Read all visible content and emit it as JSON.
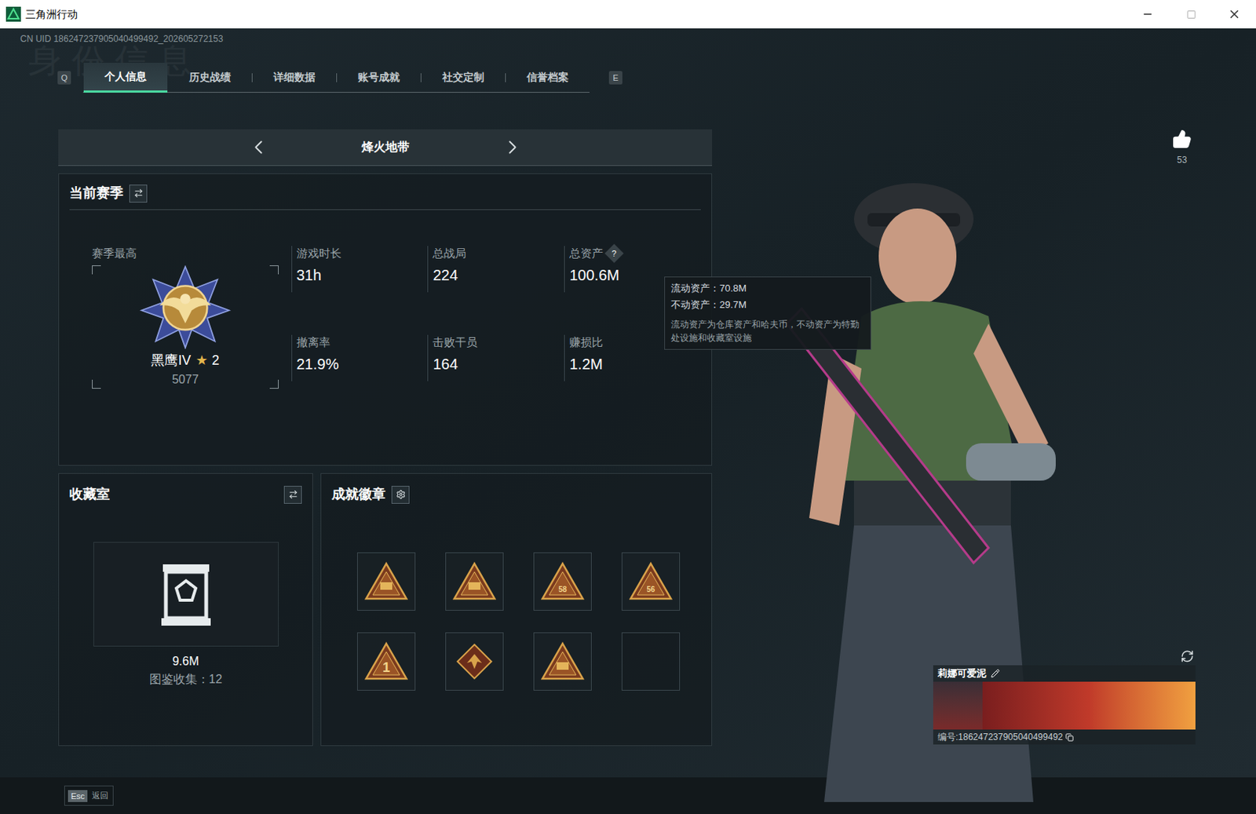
{
  "window": {
    "title": "三角洲行动"
  },
  "uid_line": "CN UID 186247237905040499492_202605272153",
  "watermark": "身份信息",
  "tabs": {
    "prev_key": "Q",
    "next_key": "E",
    "items": [
      {
        "label": "个人信息",
        "selected": true
      },
      {
        "label": "历史战绩",
        "selected": false
      },
      {
        "label": "详细数据",
        "selected": false
      },
      {
        "label": "账号成就",
        "selected": false
      },
      {
        "label": "社交定制",
        "selected": false
      },
      {
        "label": "信誉档案",
        "selected": false
      }
    ]
  },
  "mode": {
    "label": "烽火地带"
  },
  "season": {
    "title": "当前赛季",
    "rank_caption": "赛季最高",
    "rank_name": "黑鹰IV",
    "star": "★",
    "stars_text": "2",
    "score": "5077",
    "stats": [
      {
        "label": "游戏时长",
        "value": "31h"
      },
      {
        "label": "总战局",
        "value": "224"
      },
      {
        "label": "总资产",
        "value": "100.6M",
        "hint": "?"
      },
      {
        "label": "撤离率",
        "value": "21.9%"
      },
      {
        "label": "击败干员",
        "value": "164"
      },
      {
        "label": "赚损比",
        "value": "1.2M"
      }
    ]
  },
  "tooltip": {
    "lines": [
      "流动资产：70.8M",
      "不动资产：29.7M"
    ],
    "note": "流动资产为仓库资产和哈夫币，不动资产为特勤处设施和收藏室设施"
  },
  "collection": {
    "title": "收藏室",
    "value": "9.6M",
    "caption": "图鉴收集：12"
  },
  "achievements": {
    "title": "成就徽章",
    "badges": [
      {
        "kind": "triangle",
        "label": ""
      },
      {
        "kind": "triangle",
        "label": ""
      },
      {
        "kind": "triangle",
        "label": "58"
      },
      {
        "kind": "triangle",
        "label": "56"
      },
      {
        "kind": "triangle",
        "label": "1"
      },
      {
        "kind": "diamond",
        "label": ""
      },
      {
        "kind": "triangle",
        "label": ""
      },
      {
        "kind": "empty",
        "label": ""
      }
    ]
  },
  "likes": "53",
  "player": {
    "name": "莉娜可爱泥",
    "id": "编号:186247237905040499492"
  },
  "footer": {
    "key": "Esc",
    "label": "返回"
  }
}
